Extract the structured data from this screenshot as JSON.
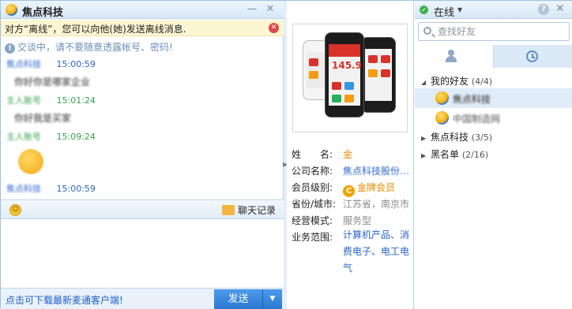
{
  "chat": {
    "title": "焦点科技",
    "minimize_label": "—",
    "close_label": "✕",
    "notice": "对方“离线”，您可以向他(她)发送离线消息.",
    "notice_close_label": "✕",
    "warning": "交谈中，请不要随意透露帐号、密码!",
    "messages": [
      {
        "sender": "焦点科技",
        "time": "15:00:59",
        "body": "你好你是哪家企业"
      },
      {
        "sender": "主人账号",
        "time": "15:01:24",
        "body": "你好我是买家"
      },
      {
        "sender": "主人账号",
        "time": "15:09:24",
        "body": ""
      },
      {
        "sender": "焦点科技",
        "time": "15:00:59",
        "body": ""
      }
    ],
    "history_label": "聊天记录",
    "download_link": "点击可下载最新麦通客户端!",
    "send_label": "发送"
  },
  "profile": {
    "rows": [
      {
        "key": "姓　　名:",
        "value": "金"
      },
      {
        "key": "公司名称:",
        "value": "焦点科技股份…"
      },
      {
        "key": "会员级别:",
        "value": "金牌会员"
      },
      {
        "key": "省份/城市:",
        "value": "江苏省，南京市"
      },
      {
        "key": "经营模式:",
        "value": "服务型"
      },
      {
        "key": "业务范围:",
        "value": "计算机产品、消费电子、电工电气"
      }
    ],
    "phone_display": "145.9"
  },
  "friends": {
    "status": "在线",
    "close_label": "✕",
    "help_label": "?",
    "search_placeholder": "查找好友",
    "groups": [
      {
        "name": "我的好友",
        "count": "(4/4)"
      },
      {
        "name": "焦点科技",
        "count": "(3/5)"
      },
      {
        "name": "黑名单",
        "count": "(2/16)"
      }
    ],
    "items": [
      {
        "name": "焦点科技"
      },
      {
        "name": "中国制造网"
      }
    ]
  }
}
